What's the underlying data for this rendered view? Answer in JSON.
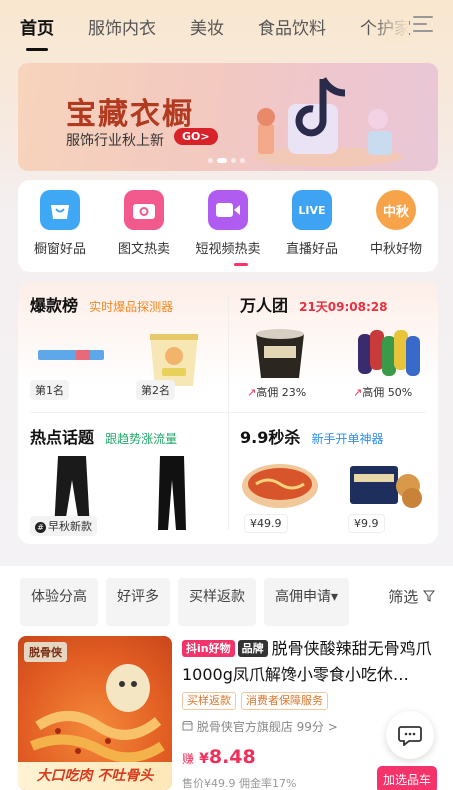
{
  "tabs": [
    {
      "label": "首页",
      "active": true
    },
    {
      "label": "服饰内衣",
      "active": false
    },
    {
      "label": "美妆",
      "active": false
    },
    {
      "label": "食品饮料",
      "active": false
    },
    {
      "label": "个护家",
      "active": false
    }
  ],
  "banner": {
    "title": "宝藏衣橱",
    "subtitle": "服饰行业秋上新",
    "cta": "GO>"
  },
  "categories": [
    {
      "label": "橱窗好品",
      "icon": "shopping-bag-icon",
      "color": "#3fa8f5"
    },
    {
      "label": "图文热卖",
      "icon": "camera-icon",
      "color": "#f25a8e"
    },
    {
      "label": "短视频热卖",
      "icon": "video-camera-icon",
      "color": "#b05cf0"
    },
    {
      "label": "直播好品",
      "icon": "live-tv-icon",
      "color": "#3ea3f2",
      "icon_text": "LIVE"
    },
    {
      "label": "中秋好物",
      "icon": "mid-autumn-icon",
      "color": "#f7a34a",
      "icon_text": "中秋"
    }
  ],
  "feature": {
    "bestsellers": {
      "title": "爆款榜",
      "subtitle": "实时爆品探测器",
      "rank1": "第1名",
      "rank2": "第2名"
    },
    "group": {
      "title": "万人团",
      "countdown": "21天09:08:28",
      "commission1": "高佣 23%",
      "commission2": "高佣 50%"
    },
    "topics": {
      "title": "热点话题",
      "subtitle": "跟趋势涨流量",
      "tag": "早秋新款"
    },
    "flash": {
      "title": "9.9秒杀",
      "subtitle": "新手开单神器",
      "price1": "¥49.9",
      "price2": "¥9.9"
    }
  },
  "filters": {
    "chips": [
      "体验分高",
      "好评多",
      "买样返款",
      "高佣申请▾"
    ],
    "filter_label": "筛选"
  },
  "product": {
    "badge_dy": "抖in好物",
    "badge_brand": "品牌",
    "title": "脱骨侠酸辣甜无骨鸡爪1000g凤爪解馋小零食小吃休…",
    "tags": [
      "买样返款",
      "消费者保障服务"
    ],
    "shop": "脱骨侠官方旗舰店 99分 >",
    "earn_label": "赚",
    "earn_currency": "¥",
    "earn_amount": "8.48",
    "meta": "售价¥49.9  佣金率17%",
    "add_button": "加选品车",
    "brand_logo": "脱骨侠",
    "slogan": "大口吃肉 不吐骨头"
  },
  "colors": {
    "accent": "#f5336b",
    "countdown": "#e8303f",
    "green_sub": "#25a86b",
    "blue_sub": "#2a8ff0",
    "orange_sub": "#f08a24"
  }
}
